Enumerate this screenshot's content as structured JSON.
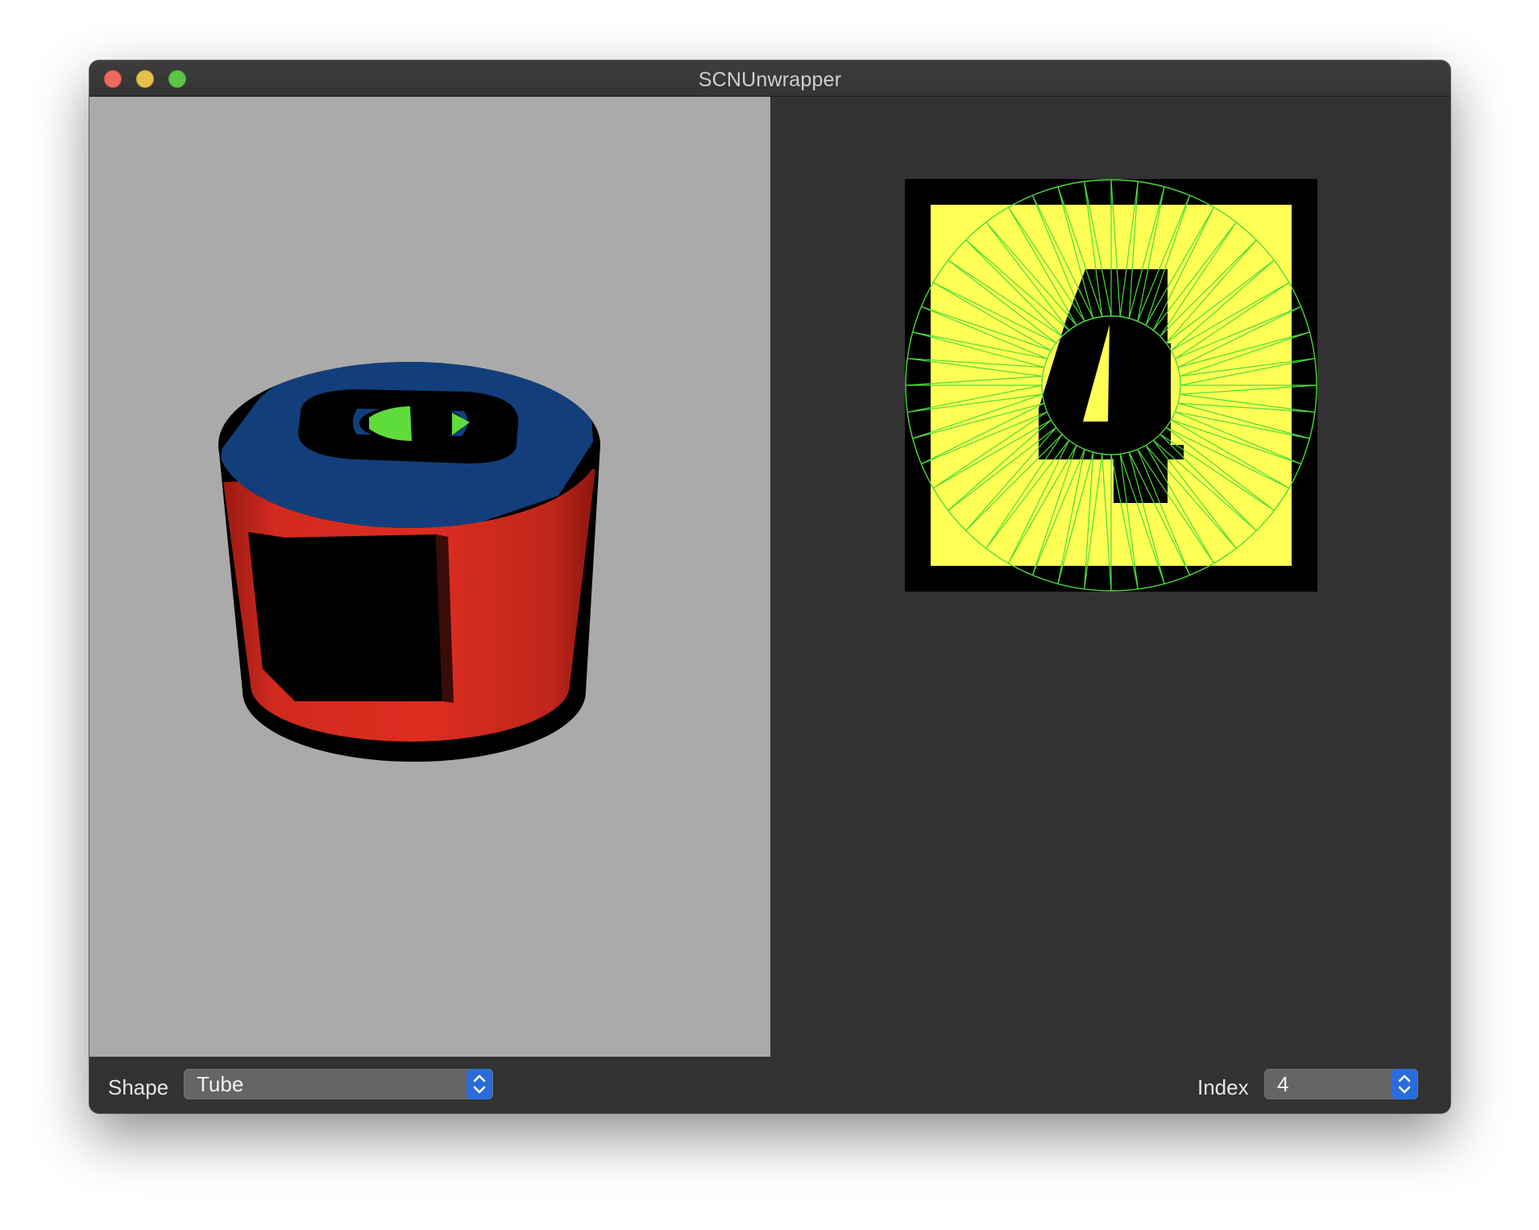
{
  "window": {
    "title": "SCNUnwrapper"
  },
  "scene": {
    "description_colors": {
      "background": "#aaaaaa",
      "tube_side": "#d42a1e",
      "tube_top": "#123f7c",
      "inner": "#5fdc3c"
    }
  },
  "texture": {
    "digit": "4",
    "colors": {
      "background": "#000000",
      "fill": "#ffff55",
      "wireframe": "#4ddc3a"
    }
  },
  "controls": {
    "shape_label": "Shape",
    "shape_value": "Tube",
    "index_label": "Index",
    "index_value": "4"
  }
}
